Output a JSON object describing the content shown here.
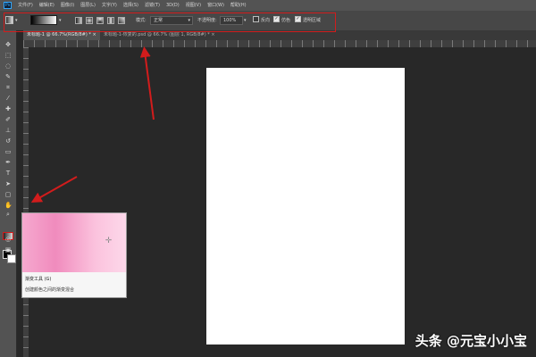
{
  "app": {
    "logo": "Ps"
  },
  "menu": [
    "文件(F)",
    "编辑(E)",
    "图像(I)",
    "图层(L)",
    "文字(Y)",
    "选择(S)",
    "滤镜(T)",
    "3D(D)",
    "视图(V)",
    "窗口(W)",
    "帮助(H)"
  ],
  "options": {
    "mode_label": "模式:",
    "mode_value": "正常",
    "opacity_label": "不透明度:",
    "opacity_value": "100%",
    "reverse_label": "反向",
    "dither_label": "仿色",
    "transparency_label": "透明区域",
    "reverse_checked": false,
    "dither_checked": true,
    "transparency_checked": true
  },
  "tabs": [
    {
      "label": "未标题-1 @ 66.7%(RGB/8#) *",
      "active": true
    },
    {
      "label": "未标题-1-恢复的.psd @ 66.7% (图层 1, RGB/8#) *",
      "active": false
    }
  ],
  "tooltip": {
    "title": "渐变工具 (G)",
    "description": "创建颜色之间的渐变混合",
    "gradient_colors": [
      "#f6a9cf",
      "#f08bbd",
      "#fbc2dd",
      "#fdd8ea"
    ]
  },
  "watermark": "头条 @元宝小小宝",
  "colors": {
    "annotation_red": "#d21c1c",
    "document": "#ffffff",
    "workspace": "#282828"
  }
}
